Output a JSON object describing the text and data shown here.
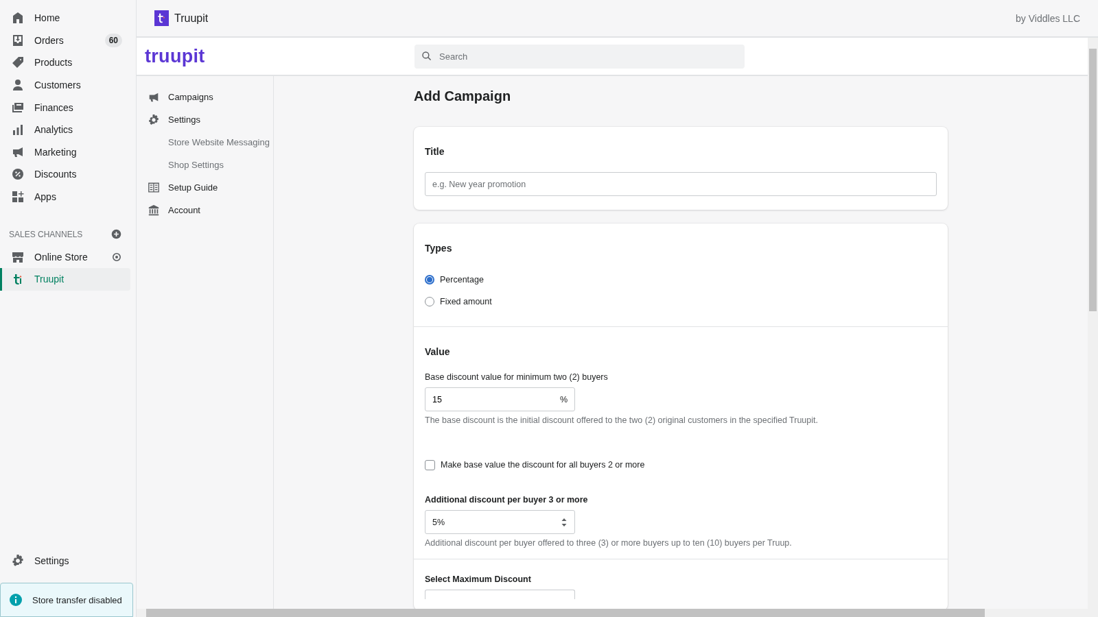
{
  "admin_nav": {
    "items": [
      {
        "label": "Home",
        "selected": false
      },
      {
        "label": "Orders",
        "badge": "60",
        "selected": false
      },
      {
        "label": "Products",
        "selected": false
      },
      {
        "label": "Customers",
        "selected": false
      },
      {
        "label": "Finances",
        "selected": false
      },
      {
        "label": "Analytics",
        "selected": false
      },
      {
        "label": "Marketing",
        "selected": false
      },
      {
        "label": "Discounts",
        "selected": false
      },
      {
        "label": "Apps",
        "selected": false
      }
    ],
    "sales_channels": {
      "heading": "SALES CHANNELS",
      "items": [
        {
          "label": "Online Store",
          "selected": false
        },
        {
          "label": "Truupit",
          "selected": true
        }
      ]
    },
    "settings": "Settings",
    "banner": "Store transfer disabled"
  },
  "app_bar": {
    "title": "Truupit",
    "publisher": "by Viddles LLC"
  },
  "app": {
    "logo": "truupit",
    "search": {
      "placeholder": "Search"
    },
    "nav": [
      {
        "label": "Campaigns"
      },
      {
        "label": "Settings",
        "children": [
          {
            "label": "Store Website Messaging"
          },
          {
            "label": "Shop Settings"
          }
        ]
      },
      {
        "label": "Setup Guide"
      },
      {
        "label": "Account"
      }
    ]
  },
  "page": {
    "title": "Add Campaign",
    "title_field": {
      "label": "Title",
      "placeholder": "e.g. New year promotion"
    },
    "types": {
      "heading": "Types",
      "options": [
        {
          "label": "Percentage",
          "selected": true
        },
        {
          "label": "Fixed amount",
          "selected": false
        }
      ]
    },
    "value": {
      "heading": "Value",
      "base": {
        "label": "Base discount value for minimum two (2) buyers",
        "value": "15",
        "suffix": "%",
        "help": "The base discount is the initial discount offered to the two (2) original customers in the specified Truupit."
      },
      "all_buyers": {
        "label": "Make base value the discount for all buyers 2 or more",
        "checked": false
      },
      "additional": {
        "label": "Additional discount per buyer 3 or more",
        "value": "5%",
        "help": "Additional discount per buyer offered to three (3) or more buyers up to ten (10) buyers per Truup."
      }
    },
    "max_discount": {
      "label": "Select Maximum Discount"
    }
  }
}
